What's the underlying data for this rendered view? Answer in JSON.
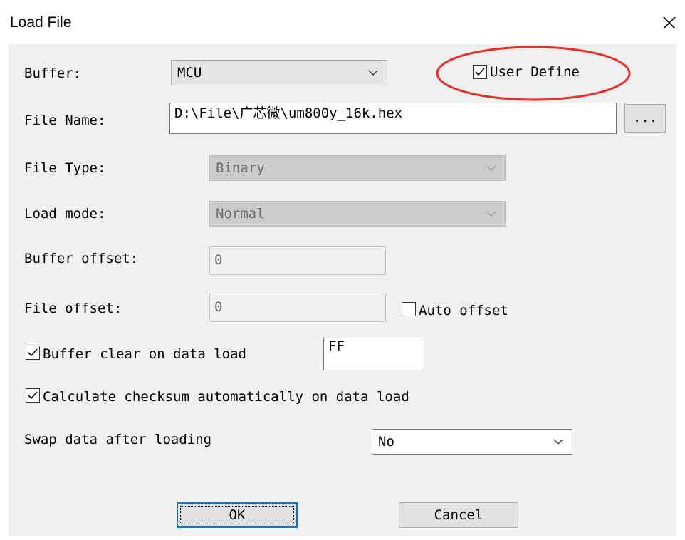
{
  "window": {
    "title": "Load File"
  },
  "buffer": {
    "label": "Buffer:",
    "value": "MCU",
    "user_define_label": "User Define",
    "user_define_checked": true
  },
  "file_name": {
    "label": "File Name:",
    "value": "D:\\File\\广芯微\\um800y_16k.hex",
    "browse_label": "..."
  },
  "file_type": {
    "label": "File Type:",
    "value": "Binary"
  },
  "load_mode": {
    "label": "Load mode:",
    "value": "Normal"
  },
  "buffer_offset": {
    "label": "Buffer offset:",
    "value": "0"
  },
  "file_offset": {
    "label": "File offset:",
    "value": "0",
    "auto_offset_label": "Auto offset",
    "auto_offset_checked": false
  },
  "buffer_clear": {
    "label": "Buffer clear on data load",
    "checked": true,
    "value": "FF"
  },
  "checksum": {
    "label": "Calculate checksum automatically on data load",
    "checked": true
  },
  "swap": {
    "label": "Swap data after loading",
    "value": "No"
  },
  "buttons": {
    "ok": "OK",
    "cancel": "Cancel"
  },
  "colors": {
    "annotation_circle": "#e8302a",
    "focus_border": "#0078d7"
  }
}
